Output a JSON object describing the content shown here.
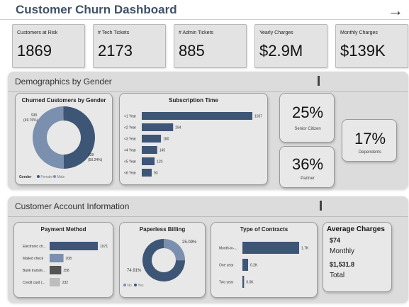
{
  "header": {
    "title": "Customer Churn Dashboard",
    "nav_icon": "arrow-right-icon"
  },
  "kpis": [
    {
      "label": "Customers at Risk",
      "value": "1869"
    },
    {
      "label": "# Tech Tickets",
      "value": "2173"
    },
    {
      "label": "# Admin Tickets",
      "value": "885"
    },
    {
      "label": "Yearly Charges",
      "value": "$2.9M"
    },
    {
      "label": "Monthly Charges",
      "value": "$139K"
    }
  ],
  "demographics": {
    "title": "Demographics by Gender",
    "gender_card": {
      "title": "Churned Customers by Gender",
      "female_label": "930",
      "female_pct": "(49.76%)",
      "male_label": "939",
      "male_pct": "(50.24%)",
      "legend_title": "Gender",
      "legend_items": [
        "Female",
        "Male"
      ]
    },
    "subscription_card": {
      "title": "Subscription Time"
    },
    "senior": {
      "value": "25%",
      "label": "Senior Citizen"
    },
    "partner": {
      "value": "36%",
      "label": "Partner"
    },
    "dependents": {
      "value": "17%",
      "label": "Dependents"
    }
  },
  "account": {
    "title": "Customer Account Information",
    "payment_card": {
      "title": "Payment Method"
    },
    "paperless_card": {
      "title": "Paperless Billing",
      "yes_pct": "74.91%",
      "no_pct": "25.09%",
      "legend_items": [
        "No",
        "Yes"
      ]
    },
    "contracts_card": {
      "title": "Type of Contracts"
    },
    "avg_charges": {
      "title": "Average Charges",
      "monthly_value": "$74",
      "monthly_label": "Monthly",
      "total_value": "$1,531.8",
      "total_label": "Total"
    }
  },
  "colors": {
    "primary": "#3e5676",
    "secondary": "#7b8fae",
    "gray_dark": "#555555",
    "gray_light": "#bdbdbd"
  },
  "chart_data": [
    {
      "type": "pie",
      "title": "Churned Customers by Gender",
      "categories": [
        "Female",
        "Male"
      ],
      "values": [
        930,
        939
      ]
    },
    {
      "type": "bar",
      "title": "Subscription Time",
      "categories": [
        "<1 Year",
        "<2 Year",
        "<3 Year",
        "<4 Year",
        "<5 Year",
        "<6 Year"
      ],
      "values": [
        1037,
        294,
        180,
        145,
        120,
        93
      ]
    },
    {
      "type": "bar",
      "title": "Payment Method",
      "categories": [
        "Electronic ch...",
        "Mailed check",
        "Bank transfe...",
        "Credit card (..."
      ],
      "values": [
        1071,
        308,
        258,
        232
      ]
    },
    {
      "type": "pie",
      "title": "Paperless Billing",
      "categories": [
        "No",
        "Yes"
      ],
      "values": [
        25.09,
        74.91
      ]
    },
    {
      "type": "bar",
      "title": "Type of Contracts",
      "categories": [
        "Month-to-...",
        "One year",
        "Two year"
      ],
      "value_labels": [
        "1.7K",
        "0.2K",
        "0.0K"
      ],
      "values": [
        1655,
        166,
        48
      ]
    }
  ]
}
